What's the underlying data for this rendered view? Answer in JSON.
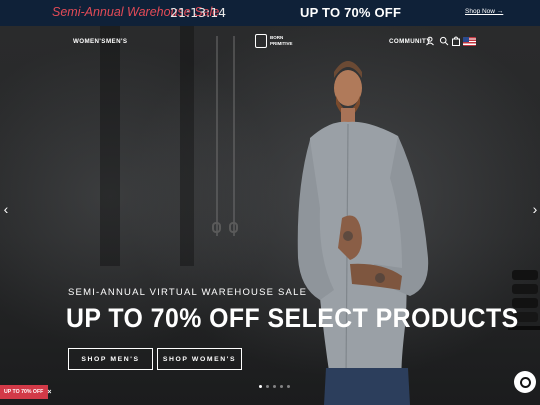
{
  "announcement": {
    "sale_text": "Semi-Annual Warehouse Sale",
    "timer": "21:13:14",
    "headline": "UP TO 70% OFF",
    "shop_link": "Shop Now →"
  },
  "nav": {
    "left_links": [
      "WOMEN'S",
      "MEN'S"
    ],
    "logo_lines": [
      "BORN",
      "PRIMITIVE"
    ],
    "right_link": "COMMUNITY",
    "icons": [
      "user-icon",
      "search-icon",
      "bag-icon",
      "us-flag-icon"
    ]
  },
  "hero": {
    "eyebrow": "SEMI-ANNUAL VIRTUAL WAREHOUSE SALE",
    "headline": "UP TO 70% OFF SELECT PRODUCTS",
    "buttons": [
      "SHOP MEN'S",
      "SHOP WOMEN'S"
    ],
    "slides_total": 5,
    "active_slide": 1
  },
  "promo_badge": {
    "label": "UP TO 70% OFF",
    "close_icon": "×"
  },
  "carousel": {
    "prev_icon": "‹",
    "next_icon": "›"
  },
  "colors": {
    "announcement_bg": "#0f2138",
    "sale_text": "#e24b57",
    "promo_bg": "#d23a48"
  }
}
